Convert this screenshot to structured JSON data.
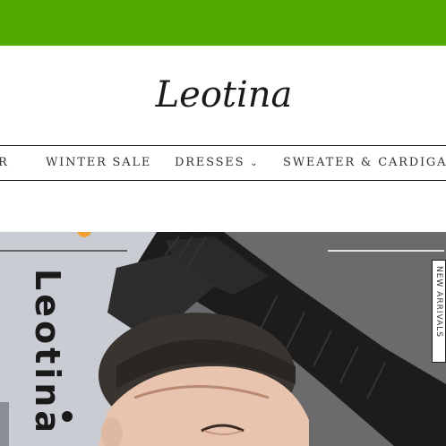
{
  "colors": {
    "topbar": "#52aa00",
    "nav_border": "#222222",
    "banner_bg": "#c9ccd2"
  },
  "header": {
    "logo_text": "Leotina"
  },
  "nav": {
    "items": [
      {
        "label": "R"
      },
      {
        "label": "WINTER SALE"
      },
      {
        "label": "DRESSES",
        "has_dropdown": true,
        "chevron_icon": "chevron-down-icon"
      },
      {
        "label": "SWEATER & CARDIGAN"
      }
    ]
  },
  "banner": {
    "brand_text": "Leotina",
    "side_label": "NEW ARRIVALS"
  }
}
